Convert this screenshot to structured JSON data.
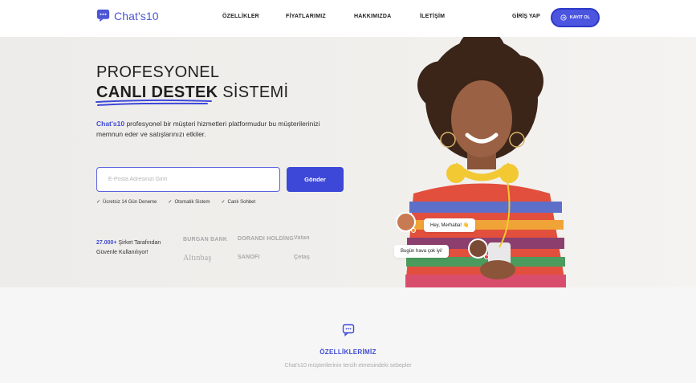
{
  "header": {
    "brand": "Chat's10",
    "nav": [
      "ÖZELLİKLER",
      "FİYATLARIMIZ",
      "HAKKIMIZDA",
      "İLETİŞİM"
    ],
    "login": "GİRİŞ YAP",
    "signup": "KAYIT OL",
    "colors": {
      "accent": "#4b55e0",
      "brand": "#4b55d6"
    }
  },
  "hero": {
    "title_line1": "PROFESYONEL",
    "title_bold": "CANLI DESTEK",
    "title_rest": " SİSTEMİ",
    "desc_brand": "Chat's10",
    "desc_text": " profesyonel bir müşteri hizmetleri platformudur bu müşterilerinizi memnun eder ve satışlarınızı etkiler.",
    "email_placeholder": "E-Posta Adresinizi Girin",
    "send_button": "Gönder",
    "features": [
      "Ücretsiz 14 Gün Deneme",
      "Otomatik Sistem",
      "Canlı Sohbet"
    ],
    "trust_num": "27.000+",
    "trust_text": " Şirket Tarafından Güvenle Kullanılıyor!",
    "partners": [
      "BURGAN BANK",
      "DORANDI HOLDİNG",
      "Vatan",
      "Altınbaş",
      "SANOFI",
      "Çetaş"
    ],
    "chat": {
      "bubble1": "Hey, Merhaba! 👋",
      "bubble2": "Bugün hava çok iyi!"
    }
  },
  "features_section": {
    "title": "ÖZELLİKLERİMİZ",
    "subtitle": "Chat's10 müşterilerinin tercih etmesindeki sebepler"
  }
}
